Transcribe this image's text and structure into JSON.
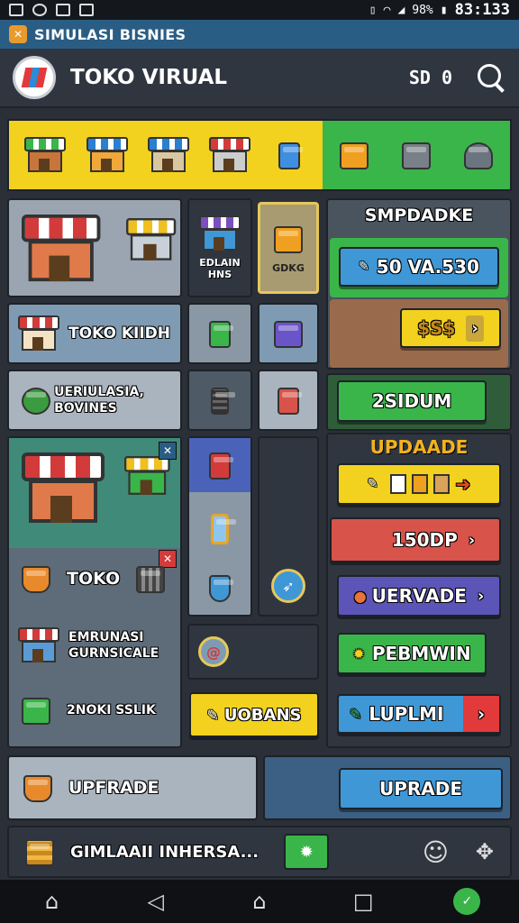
{
  "status_bar": {
    "battery": "98%",
    "time": "83:133"
  },
  "app_bar": {
    "title": "SIMULASI BISNIES"
  },
  "header": {
    "shop_name": "TOKO VIRUAL",
    "coins": "SD 0"
  },
  "store_panel": {
    "title": "SMPDADKE",
    "price_button": "50 VA.530",
    "cost_button": "$S$",
    "start_button": "2SIDUM",
    "upgrade_heading": "UPDAADE",
    "upgrade_options": [
      {
        "label": ""
      },
      {
        "label": "150DP"
      },
      {
        "label": "UERVADE"
      },
      {
        "label": "PEBMWIN"
      },
      {
        "label": "LUPLMI"
      }
    ],
    "bottom_upgrade_button": "UPRADE"
  },
  "left_list": {
    "toko_kidh": "TOKO KIIDH",
    "buildings_label": "UERIULASIA, BOVINES",
    "toko": "TOKO",
    "simulasi_gurns": "EMRUNASI GURNSICALE",
    "snoki": "2NOKI SSLIK"
  },
  "mid_tiles": {
    "eduin_label": "EDLAIN HNS",
    "gdkg_label": "GDKG",
    "uobans_button": "UOBANS"
  },
  "bottom_row": {
    "upgrade_label": "UPFRADE"
  },
  "footer": {
    "label": "GIMLAAII INHERSA..."
  },
  "colors": {
    "accent_green": "#3ab54a",
    "accent_yellow": "#f2d21e",
    "accent_blue": "#3f97d6",
    "accent_red": "#d8534a",
    "accent_purple": "#5b55b8",
    "panel_dark": "#2f3640"
  }
}
